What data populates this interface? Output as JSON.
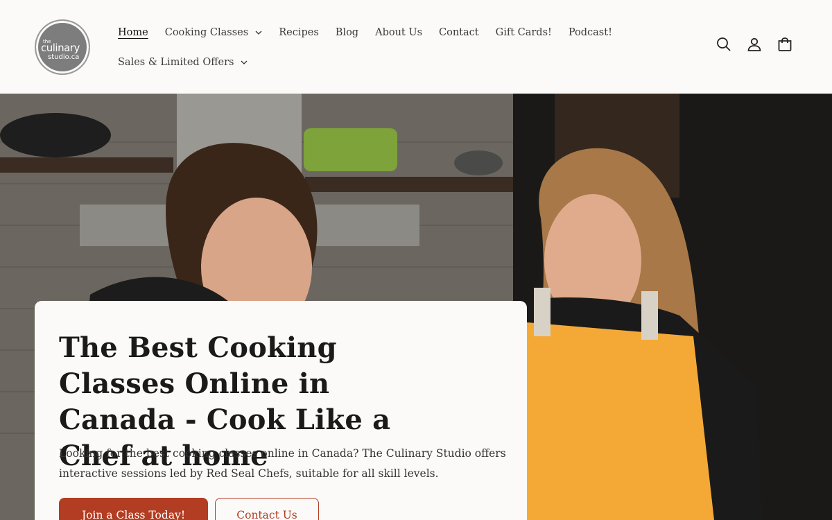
{
  "logo": {
    "the": "the",
    "line1": "culinary",
    "line2": "studio.ca"
  },
  "nav": {
    "row1": [
      {
        "label": "Home",
        "active": true,
        "dropdown": false
      },
      {
        "label": "Cooking Classes",
        "active": false,
        "dropdown": true
      },
      {
        "label": "Recipes",
        "active": false,
        "dropdown": false
      },
      {
        "label": "Blog",
        "active": false,
        "dropdown": false
      },
      {
        "label": "About Us",
        "active": false,
        "dropdown": false
      },
      {
        "label": "Contact",
        "active": false,
        "dropdown": false
      },
      {
        "label": "Gift Cards!",
        "active": false,
        "dropdown": false
      },
      {
        "label": "Podcast!",
        "active": false,
        "dropdown": false
      }
    ],
    "row2": [
      {
        "label": "Sales & Limited Offers",
        "active": false,
        "dropdown": true
      }
    ]
  },
  "header_icons": [
    "search-icon",
    "account-icon",
    "cart-icon"
  ],
  "hero": {
    "title": "The Best Cooking Classes Online in Canada - Cook Like a Chef at home",
    "description": "Looking for the best cooking classes online in Canada? The Culinary Studio offers interactive sessions led by Red Seal Chefs, suitable for all skill levels.",
    "primary_button": "Join a Class Today!",
    "secondary_button": "Contact Us"
  },
  "colors": {
    "accent": "#b23d22",
    "background": "#fbfaf8",
    "text": "#1a1a1a",
    "apron": "#f4a937"
  }
}
